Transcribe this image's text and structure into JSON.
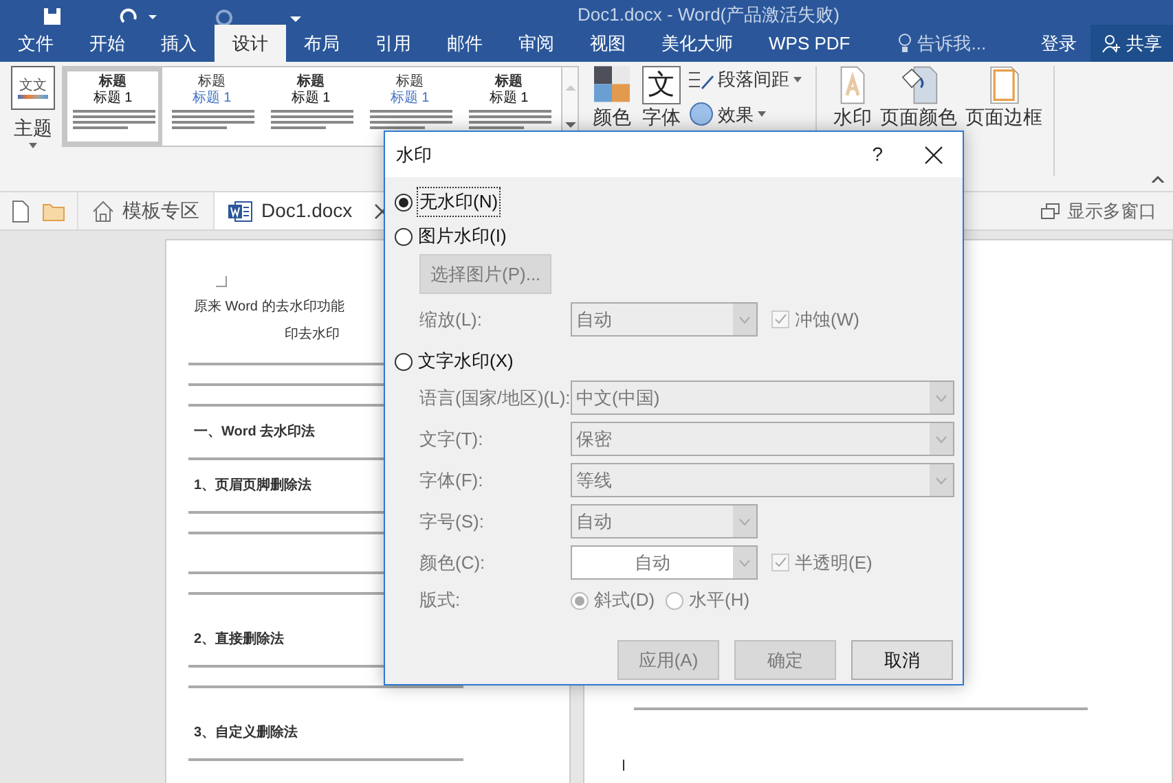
{
  "title_bar": {
    "title": "Doc1.docx - Word(产品激活失败)"
  },
  "ribbon_tabs": [
    {
      "label": "文件",
      "selected": false
    },
    {
      "label": "开始",
      "selected": false
    },
    {
      "label": "插入",
      "selected": false
    },
    {
      "label": "设计",
      "selected": true
    },
    {
      "label": "布局",
      "selected": false
    },
    {
      "label": "引用",
      "selected": false
    },
    {
      "label": "邮件",
      "selected": false
    },
    {
      "label": "审阅",
      "selected": false
    },
    {
      "label": "视图",
      "selected": false
    },
    {
      "label": "美化大师",
      "selected": false
    },
    {
      "label": "WPS PDF",
      "selected": false
    }
  ],
  "tell_me": "告诉我...",
  "sign_in": "登录",
  "share": "共享",
  "ribbon": {
    "theme_glyph": "文文",
    "theme": "主题",
    "gallery": [
      {
        "heading": "标题",
        "subheading": "标题 1",
        "selected": true
      },
      {
        "heading": "标题",
        "subheading": "标题 1",
        "selected": false
      },
      {
        "heading": "标题",
        "subheading": "标题 1",
        "selected": false
      },
      {
        "heading": "标题",
        "subheading": "标题 1",
        "selected": false
      },
      {
        "heading": "标题",
        "subheading": "标题 1",
        "selected": false
      }
    ],
    "colors": "颜色",
    "font_glyph": "文",
    "fonts": "字体",
    "paragraph_spacing": "段落间距",
    "effects": "效果",
    "watermark": "水印",
    "page_color": "页面颜色",
    "page_borders": "页面边框"
  },
  "doc_tabs": [
    {
      "kind": "home",
      "label": "模板专区",
      "selected": false
    },
    {
      "kind": "word",
      "label": "Doc1.docx",
      "selected": true
    }
  ],
  "multi_window": "显示多窗口",
  "document": {
    "lines": [
      {
        "kind": "title",
        "text": "原来 Word 的去水印功能"
      },
      {
        "kind": "title2",
        "text": "印去水印"
      },
      {
        "kind": "body"
      },
      {
        "kind": "body"
      },
      {
        "kind": "body"
      },
      {
        "kind": "heading",
        "text": "一、Word 去水印法"
      },
      {
        "kind": "body"
      },
      {
        "kind": "heading",
        "text": "1、页眉页脚删除法"
      },
      {
        "kind": "body"
      },
      {
        "kind": "body"
      },
      {
        "kind": "gap"
      },
      {
        "kind": "body"
      },
      {
        "kind": "body"
      },
      {
        "kind": "gap"
      },
      {
        "kind": "heading",
        "text": "2、直接删除法"
      },
      {
        "kind": "body"
      },
      {
        "kind": "body"
      },
      {
        "kind": "gap"
      },
      {
        "kind": "heading",
        "text": "3、自定义删除法"
      },
      {
        "kind": "body"
      }
    ]
  },
  "dialog": {
    "title": "水印",
    "help": "?",
    "options": [
      {
        "label": "无水印(N)",
        "selected": true
      },
      {
        "label": "图片水印(I)",
        "selected": false
      },
      {
        "label": "文字水印(X)",
        "selected": false
      }
    ],
    "select_picture": {
      "label": "选择图片(P)...",
      "disabled": true
    },
    "scale": {
      "label": "缩放(L):",
      "value": "自动"
    },
    "washout": {
      "label": "冲蚀(W)",
      "checked": true
    },
    "language": {
      "label": "语言(国家/地区)(L):",
      "value": "中文(中国)"
    },
    "text": {
      "label": "文字(T):",
      "value": "保密"
    },
    "font": {
      "label": "字体(F):",
      "value": "等线"
    },
    "size": {
      "label": "字号(S):",
      "value": "自动"
    },
    "color": {
      "label": "颜色(C):",
      "value": "自动"
    },
    "semitransparent": {
      "label": "半透明(E)",
      "checked": true
    },
    "layout": {
      "label": "版式:",
      "options": [
        {
          "label": "斜式(D)",
          "selected": true
        },
        {
          "label": "水平(H)",
          "selected": false
        }
      ]
    },
    "buttons": [
      {
        "label": "应用(A)",
        "disabled": true
      },
      {
        "label": "确定",
        "disabled": true
      },
      {
        "label": "取消",
        "disabled": false
      }
    ]
  }
}
